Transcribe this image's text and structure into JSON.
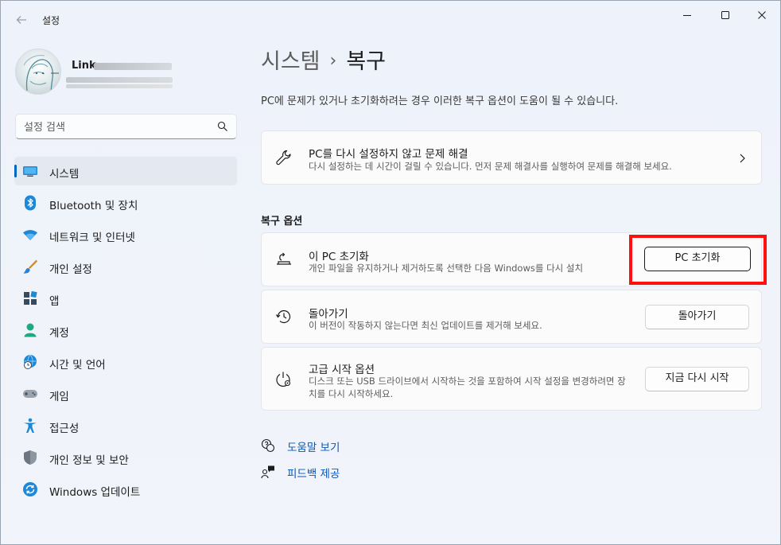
{
  "window": {
    "app_title": "설정",
    "colors": {
      "accent": "#0067c0",
      "highlight": "#ff1010",
      "link": "#0b57b5"
    }
  },
  "user": {
    "name": "Link"
  },
  "search": {
    "placeholder": "설정 검색"
  },
  "sidebar": {
    "items": [
      {
        "label": "시스템",
        "icon": "system-icon",
        "active": true
      },
      {
        "label": "Bluetooth 및 장치",
        "icon": "bluetooth-icon"
      },
      {
        "label": "네트워크 및 인터넷",
        "icon": "wifi-icon"
      },
      {
        "label": "개인 설정",
        "icon": "brush-icon"
      },
      {
        "label": "앱",
        "icon": "apps-icon"
      },
      {
        "label": "계정",
        "icon": "account-icon"
      },
      {
        "label": "시간 및 언어",
        "icon": "globe-clock-icon"
      },
      {
        "label": "게임",
        "icon": "gamepad-icon"
      },
      {
        "label": "접근성",
        "icon": "accessibility-icon"
      },
      {
        "label": "개인 정보 및 보안",
        "icon": "shield-icon"
      },
      {
        "label": "Windows 업데이트",
        "icon": "update-icon"
      }
    ]
  },
  "header": {
    "parent": "시스템",
    "separator": "›",
    "current": "복구",
    "subtitle": "PC에 문제가 있거나 초기화하려는 경우 이러한 복구 옵션이 도움이 될 수 있습니다."
  },
  "troubleshoot_card": {
    "title": "PC를 다시 설정하지 않고 문제 해결",
    "desc": "다시 설정하는 데 시간이 걸릴 수 있습니다. 먼저 문제 해결사를 실행하여 문제를 해결해 보세요.",
    "icon": "wrench-icon"
  },
  "recovery_options": {
    "section_title": "복구 옵션",
    "items": [
      {
        "title": "이 PC 초기화",
        "desc": "개인 파일을 유지하거나 제거하도록 선택한 다음 Windows를 다시 설치",
        "button": "PC 초기화",
        "icon": "reset-pc-icon"
      },
      {
        "title": "돌아가기",
        "desc": "이 버전이 작동하지 않는다면 최신 업데이트를 제거해 보세요.",
        "button": "돌아가기",
        "icon": "history-icon"
      },
      {
        "title": "고급 시작 옵션",
        "desc": "디스크 또는 USB 드라이브에서 시작하는 것을 포함하여 시작 설정을 변경하려면 장치를 다시 시작하세요.",
        "button": "지금 다시 시작",
        "icon": "advanced-startup-icon"
      }
    ]
  },
  "links": {
    "help": "도움말 보기",
    "feedback": "피드백 제공"
  }
}
